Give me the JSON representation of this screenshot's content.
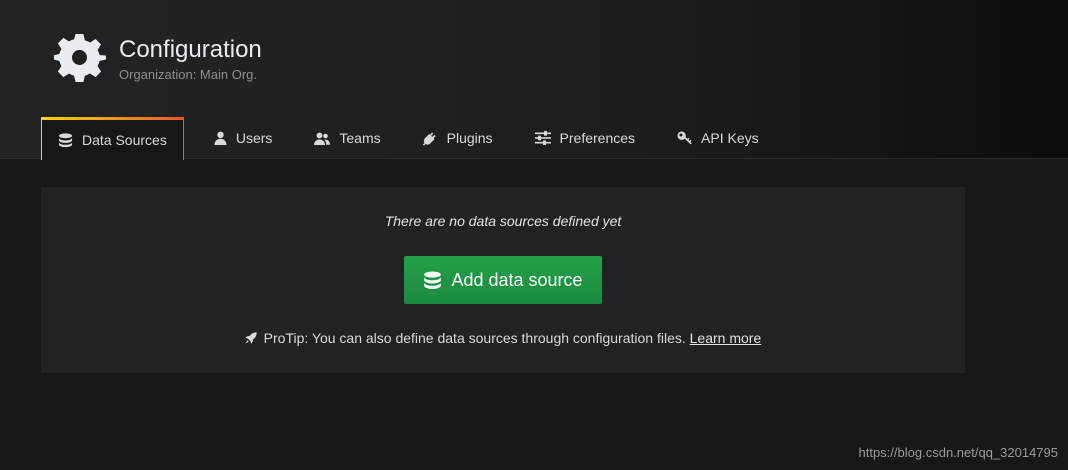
{
  "header": {
    "title": "Configuration",
    "subtitle": "Organization: Main Org.",
    "icon": "gear-icon"
  },
  "tabs": [
    {
      "label": "Data Sources",
      "icon": "database-icon",
      "active": true
    },
    {
      "label": "Users",
      "icon": "user-icon",
      "active": false
    },
    {
      "label": "Teams",
      "icon": "team-icon",
      "active": false
    },
    {
      "label": "Plugins",
      "icon": "plug-icon",
      "active": false
    },
    {
      "label": "Preferences",
      "icon": "sliders-icon",
      "active": false
    },
    {
      "label": "API Keys",
      "icon": "key-icon",
      "active": false
    }
  ],
  "empty_state": {
    "message": "There are no data sources defined yet",
    "button_label": "Add data source",
    "protip_text": "ProTip: You can also define data sources through configuration files.",
    "protip_link": "Learn more"
  },
  "watermark": "https://blog.csdn.net/qq_32014795",
  "colors": {
    "background": "#161719",
    "panel": "#202226",
    "button": "#1e9643",
    "tab_accent_start": "#ffd500",
    "tab_accent_end": "#f05a28"
  }
}
